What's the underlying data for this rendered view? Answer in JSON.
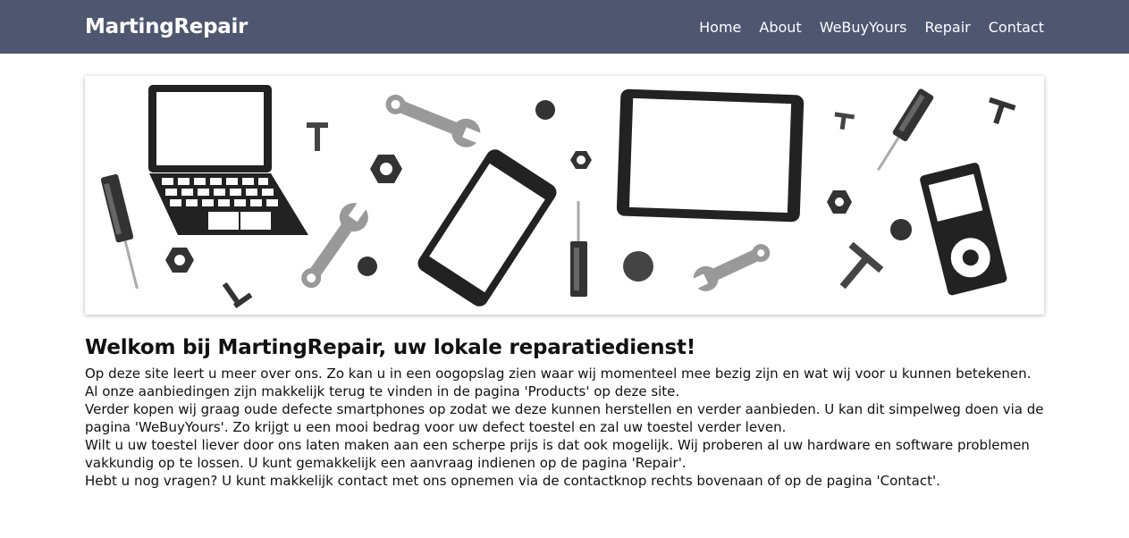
{
  "nav": {
    "brand": "MartingRepair",
    "links": [
      "Home",
      "About",
      "WeBuyYours",
      "Repair",
      "Contact"
    ]
  },
  "colors": {
    "navbar_bg": "#4e5670",
    "dark_gray": "#2c2c2c",
    "mid_gray": "#555555",
    "light_gray": "#9a9a9a"
  },
  "hero": {
    "image": "repair tools and devices illustration"
  },
  "content": {
    "heading": "Welkom bij MartingRepair, uw lokale reparatiedienst!",
    "paragraphs": [
      "Op deze site leert u meer over ons. Zo kan u in een oogopslag zien waar wij momenteel mee bezig zijn en wat wij voor u kunnen betekenen. Al onze aanbiedingen zijn makkelijk terug te vinden in de pagina 'Products' op deze site.",
      "Verder kopen wij graag oude defecte smartphones op zodat we deze kunnen herstellen en verder aanbieden. U kan dit simpelweg doen via de pagina 'WeBuyYours'. Zo krijgt u een mooi bedrag voor uw defect toestel en zal uw toestel verder leven.",
      "Wilt u uw toestel liever door ons laten maken aan een scherpe prijs is dat ook mogelijk. Wij proberen al uw hardware en software problemen vakkundig op te lossen. U kunt gemakkelijk een aanvraag indienen op de pagina 'Repair'.",
      "Hebt u nog vragen? U kunt makkelijk contact met ons opnemen via de contactknop rechts bovenaan of op de pagina 'Contact'."
    ]
  }
}
